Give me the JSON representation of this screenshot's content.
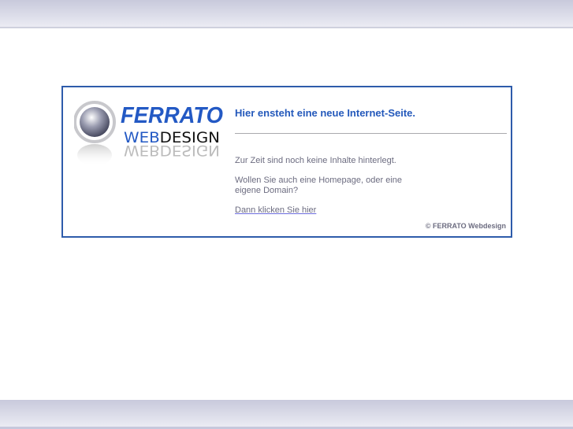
{
  "logo": {
    "brand": "FERRATO",
    "sub_blue": "WEB",
    "sub_black": "DESIGN",
    "reflection": "WEBDESIGN"
  },
  "main": {
    "headline": "Hier ensteht eine neue Internet-Seite.",
    "paragraph1": "Zur Zeit sind noch keine Inhalte hinterlegt.",
    "paragraph2": "Wollen Sie auch eine Homepage, oder eine eigene Domain?",
    "link": "Dann klicken Sie hier",
    "copyright": "© FERRATO Webdesign"
  },
  "colors": {
    "accent": "#2459bb",
    "border": "#2e5cab",
    "text": "#6c6c80"
  }
}
